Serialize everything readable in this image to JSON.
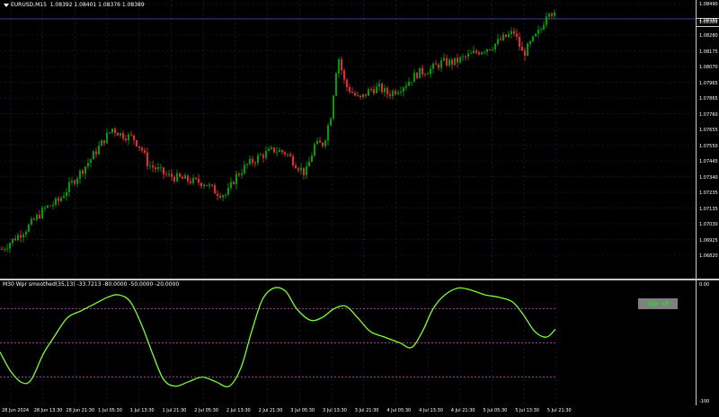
{
  "chart": {
    "symbol_info": "EURUSD,M15  1.08392 1.08401 1.08376 1.08389",
    "current_price_tag": "1.08389",
    "colors": {
      "background": "#000000",
      "bull": "#00b000",
      "bear": "#ff3030",
      "grid": "#1c2a44",
      "indicator": "#7dff30",
      "level": "#c050c0",
      "current_line": "#4040a0"
    },
    "price_axis": [
      "1.08490",
      "1.08385",
      "1.08280",
      "1.08175",
      "1.08070",
      "1.07965",
      "1.07865",
      "1.07760",
      "1.07655",
      "1.07550",
      "1.07445",
      "1.07340",
      "1.07235",
      "1.07135",
      "1.07030",
      "1.06925",
      "1.06820"
    ],
    "time_axis": [
      "28 Jun 2024",
      "28 Jun 13:30",
      "28 Jun 21:30",
      "1 Jul 05:30",
      "1 Jul 13:30",
      "1 Jul 21:30",
      "2 Jul 05:30",
      "2 Jul 13:30",
      "2 Jul 21:30",
      "3 Jul 05:30",
      "3 Jul 13:30",
      "3 Jul 21:30",
      "4 Jul 05:30",
      "4 Jul 13:30",
      "4 Jul 21:30",
      "5 Jul 05:30",
      "5 Jul 13:30",
      "5 Jul 21:30"
    ],
    "price_path": [
      [
        0,
        1.0685
      ],
      [
        10,
        1.069
      ],
      [
        30,
        1.07
      ],
      [
        50,
        1.0713
      ],
      [
        65,
        1.0718
      ],
      [
        80,
        1.073
      ],
      [
        88,
        1.0736
      ],
      [
        100,
        1.0745
      ],
      [
        115,
        1.0758
      ],
      [
        125,
        1.0766
      ],
      [
        135,
        1.0762
      ],
      [
        148,
        1.076
      ],
      [
        158,
        1.0752
      ],
      [
        165,
        1.0742
      ],
      [
        175,
        1.0739
      ],
      [
        185,
        1.0735
      ],
      [
        200,
        1.0733
      ],
      [
        215,
        1.0731
      ],
      [
        228,
        1.073
      ],
      [
        240,
        1.0724
      ],
      [
        252,
        1.0722
      ],
      [
        262,
        1.0734
      ],
      [
        275,
        1.0742
      ],
      [
        290,
        1.0748
      ],
      [
        305,
        1.0752
      ],
      [
        318,
        1.075
      ],
      [
        330,
        1.0742
      ],
      [
        340,
        1.0736
      ],
      [
        350,
        1.0755
      ],
      [
        360,
        1.0756
      ],
      [
        368,
        1.0775
      ],
      [
        376,
        1.0815
      ],
      [
        384,
        1.0795
      ],
      [
        392,
        1.079
      ],
      [
        400,
        1.0785
      ],
      [
        412,
        1.0792
      ],
      [
        422,
        1.0793
      ],
      [
        432,
        1.0789
      ],
      [
        442,
        1.0792
      ],
      [
        452,
        1.0796
      ],
      [
        465,
        1.0803
      ],
      [
        478,
        1.0805
      ],
      [
        492,
        1.081
      ],
      [
        505,
        1.081
      ],
      [
        520,
        1.0814
      ],
      [
        535,
        1.0818
      ],
      [
        548,
        1.0821
      ],
      [
        560,
        1.0826
      ],
      [
        572,
        1.083
      ],
      [
        582,
        1.0815
      ],
      [
        592,
        1.0824
      ],
      [
        602,
        1.0832
      ],
      [
        610,
        1.0846
      ],
      [
        618,
        1.084
      ]
    ]
  },
  "indicator": {
    "title": "M30 Wpr smoothed(35,13) -33.7213 -80.0000 -50.0000 -20.0000",
    "axis_top": "0.00",
    "axis_bottom": "-100",
    "levels": [
      -20,
      -50,
      -80
    ],
    "button_label": "Wpr off",
    "values": [
      [
        0,
        -58
      ],
      [
        12,
        -75
      ],
      [
        25,
        -85
      ],
      [
        35,
        -82
      ],
      [
        48,
        -60
      ],
      [
        60,
        -45
      ],
      [
        75,
        -28
      ],
      [
        90,
        -22
      ],
      [
        105,
        -16
      ],
      [
        120,
        -10
      ],
      [
        132,
        -8
      ],
      [
        145,
        -14
      ],
      [
        158,
        -35
      ],
      [
        170,
        -60
      ],
      [
        182,
        -82
      ],
      [
        195,
        -88
      ],
      [
        210,
        -84
      ],
      [
        225,
        -80
      ],
      [
        240,
        -84
      ],
      [
        255,
        -88
      ],
      [
        268,
        -72
      ],
      [
        280,
        -40
      ],
      [
        292,
        -12
      ],
      [
        305,
        -2
      ],
      [
        318,
        -5
      ],
      [
        330,
        -20
      ],
      [
        345,
        -30
      ],
      [
        358,
        -28
      ],
      [
        372,
        -20
      ],
      [
        385,
        -18
      ],
      [
        398,
        -28
      ],
      [
        412,
        -40
      ],
      [
        428,
        -45
      ],
      [
        445,
        -50
      ],
      [
        458,
        -54
      ],
      [
        470,
        -40
      ],
      [
        482,
        -20
      ],
      [
        495,
        -8
      ],
      [
        510,
        -2
      ],
      [
        525,
        -4
      ],
      [
        540,
        -8
      ],
      [
        555,
        -10
      ],
      [
        570,
        -14
      ],
      [
        582,
        -25
      ],
      [
        595,
        -40
      ],
      [
        608,
        -45
      ],
      [
        618,
        -38
      ]
    ]
  }
}
